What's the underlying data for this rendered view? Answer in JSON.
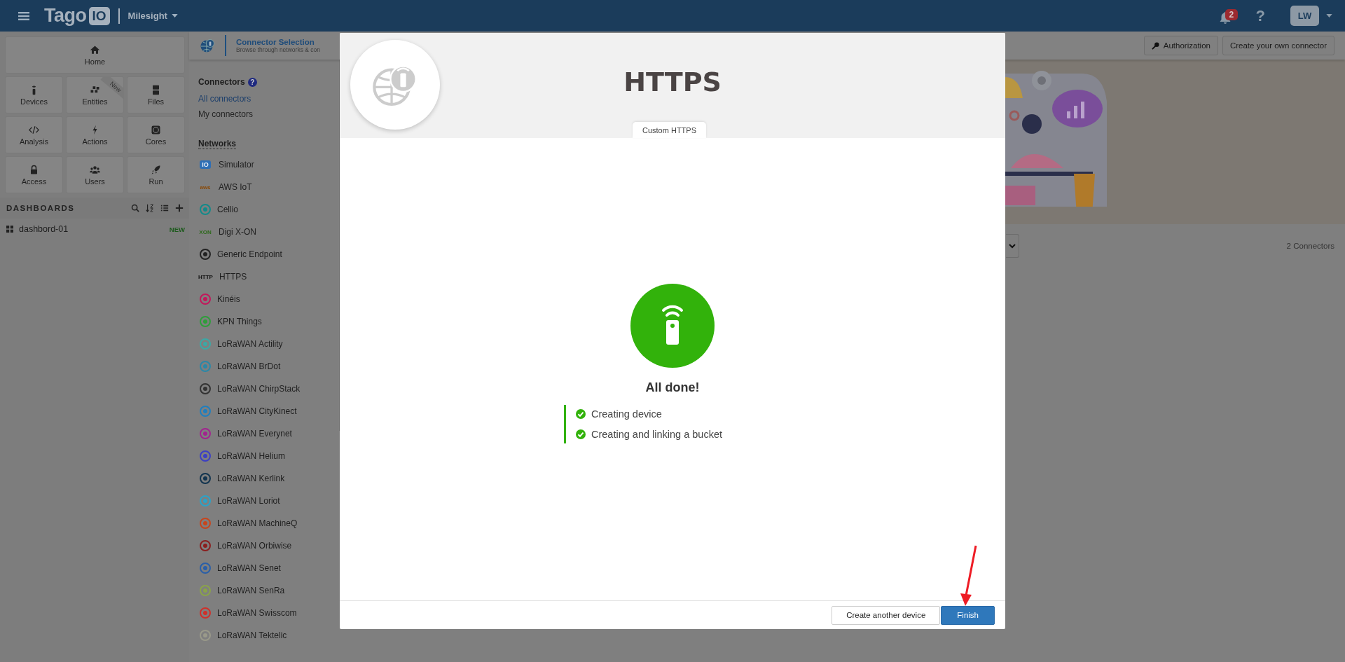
{
  "header": {
    "logo": "Tago",
    "logo_badge": "IO",
    "account": "Milesight",
    "notifications": "2",
    "help": "?",
    "user": "LW"
  },
  "nav": [
    {
      "label": "Home"
    },
    {
      "label": "Devices"
    },
    {
      "label": "Entities",
      "ribbon": "New"
    },
    {
      "label": "Files"
    },
    {
      "label": "Analysis"
    },
    {
      "label": "Actions"
    },
    {
      "label": "Cores"
    },
    {
      "label": "Access"
    },
    {
      "label": "Users"
    },
    {
      "label": "Run"
    }
  ],
  "dashboards": {
    "title": "DASHBOARDS",
    "items": [
      {
        "label": "dashbord-01",
        "badge": "NEW"
      }
    ]
  },
  "page_header": {
    "title": "Connector Selection",
    "subtitle": "Browse through networks & con"
  },
  "toolbar": [
    "Authorization",
    "Create your own connector"
  ],
  "connectors_menu": {
    "heading": "Connectors",
    "help": "?",
    "links": [
      {
        "label": "All connectors",
        "selected": true
      },
      {
        "label": "My connectors",
        "selected": false
      }
    ]
  },
  "networks": {
    "heading": "Networks",
    "items": [
      {
        "label": "Simulator",
        "logo_text": "IO",
        "kind": "badge",
        "color": "#2f6fb5"
      },
      {
        "label": "AWS IoT",
        "logo_text": "aws",
        "color": "#8a4a08"
      },
      {
        "label": "Cellio",
        "color": "#138a8a"
      },
      {
        "label": "Digi X-ON",
        "logo_text": "XON",
        "color": "#2e6a1c"
      },
      {
        "label": "Generic Endpoint",
        "color": "#222222"
      },
      {
        "label": "HTTPS",
        "logo_text": "HTTP",
        "color": "#111111"
      },
      {
        "label": "Kinéis",
        "color": "#c2185b"
      },
      {
        "label": "KPN Things",
        "color": "#2e9e3a"
      },
      {
        "label": "LoRaWAN Actility",
        "color": "#3aa9a6"
      },
      {
        "label": "LoRaWAN BrDot",
        "color": "#2a88a8"
      },
      {
        "label": "LoRaWAN ChirpStack",
        "color": "#333333"
      },
      {
        "label": "LoRaWAN CityKinect",
        "color": "#1f7fbf"
      },
      {
        "label": "LoRaWAN Everynet",
        "color": "#a3238f"
      },
      {
        "label": "LoRaWAN Helium",
        "color": "#3b3fc4"
      },
      {
        "label": "LoRaWAN Kerlink",
        "color": "#12344f"
      },
      {
        "label": "LoRaWAN Loriot",
        "color": "#2aa3c8"
      },
      {
        "label": "LoRaWAN MachineQ",
        "color": "#c8451c"
      },
      {
        "label": "LoRaWAN Orbiwise",
        "color": "#8a1e1e"
      },
      {
        "label": "LoRaWAN Senet",
        "color": "#2a5fa8"
      },
      {
        "label": "LoRaWAN SenRa",
        "color": "#8aa34a"
      },
      {
        "label": "LoRaWAN Swisscom",
        "color": "#d0302a"
      },
      {
        "label": "LoRaWAN Tektelic",
        "color": "#9a9a8a"
      }
    ]
  },
  "results_count": "2 Connectors",
  "modal": {
    "title": "HTTPS",
    "tab": "Custom HTTPS",
    "status": "All done!",
    "steps": [
      {
        "label": "Creating device",
        "done": true
      },
      {
        "label": "Creating and linking a bucket",
        "done": true
      }
    ],
    "buttons": [
      {
        "label": "Create another device",
        "kind": "secondary"
      },
      {
        "label": "Finish",
        "kind": "primary"
      }
    ]
  }
}
